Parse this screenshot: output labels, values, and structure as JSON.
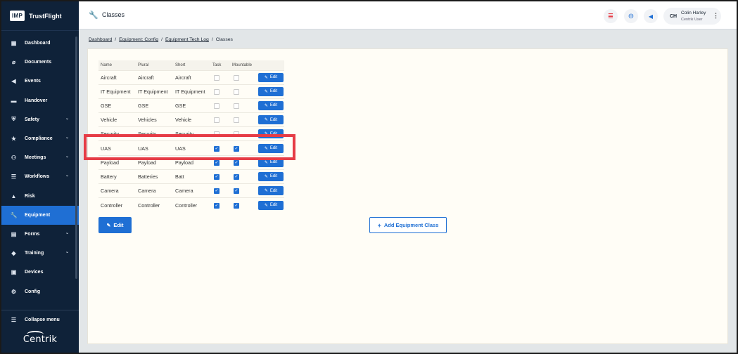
{
  "brand": {
    "logo_text": "IMP",
    "name": "TrustFlight"
  },
  "sidebar": {
    "items": [
      {
        "label": "Dashboard",
        "icon": "dashboard-icon",
        "glyph": "▦",
        "chevron": false,
        "active": false
      },
      {
        "label": "Documents",
        "icon": "paperclip-icon",
        "glyph": "⌀",
        "chevron": false,
        "active": false
      },
      {
        "label": "Events",
        "icon": "megaphone-icon",
        "glyph": "◀",
        "chevron": false,
        "active": false
      },
      {
        "label": "Handover",
        "icon": "handover-icon",
        "glyph": "▬",
        "chevron": false,
        "active": false
      },
      {
        "label": "Safety",
        "icon": "shield-icon",
        "glyph": "⛨",
        "chevron": true,
        "active": false
      },
      {
        "label": "Compliance",
        "icon": "compliance-icon",
        "glyph": "★",
        "chevron": true,
        "active": false
      },
      {
        "label": "Meetings",
        "icon": "meetings-icon",
        "glyph": "⚇",
        "chevron": true,
        "active": false
      },
      {
        "label": "Workflows",
        "icon": "workflows-icon",
        "glyph": "☰",
        "chevron": true,
        "active": false
      },
      {
        "label": "Risk",
        "icon": "risk-icon",
        "glyph": "▲",
        "chevron": false,
        "active": false
      },
      {
        "label": "Equipment",
        "icon": "wrench-icon",
        "glyph": "🔧",
        "chevron": false,
        "active": true
      },
      {
        "label": "Forms",
        "icon": "forms-icon",
        "glyph": "▤",
        "chevron": true,
        "active": false
      },
      {
        "label": "Training",
        "icon": "graduation-cap-icon",
        "glyph": "◆",
        "chevron": true,
        "active": false
      },
      {
        "label": "Devices",
        "icon": "devices-icon",
        "glyph": "▣",
        "chevron": false,
        "active": false
      },
      {
        "label": "Config",
        "icon": "config-icon",
        "glyph": "⚙",
        "chevron": false,
        "active": false
      }
    ],
    "collapse_label": "Collapse menu",
    "footer_logo": "Centrik"
  },
  "header": {
    "title": "Classes",
    "user": {
      "initials": "CH",
      "name": "Colin Harley",
      "role": "Centrik User"
    }
  },
  "breadcrumb": [
    "Dashboard",
    "Equipment: Config",
    "Equipment Tech Log",
    "Classes"
  ],
  "table": {
    "columns": [
      "Name",
      "Plural",
      "Short",
      "Task",
      "Mountable"
    ],
    "edit_label": "Edit",
    "rows": [
      {
        "name": "Aircraft",
        "plural": "Aircraft",
        "short": "Aircraft",
        "task": false,
        "mountable": false
      },
      {
        "name": "IT Equipment",
        "plural": "IT Equipment",
        "short": "IT Equipment",
        "task": false,
        "mountable": false
      },
      {
        "name": "GSE",
        "plural": "GSE",
        "short": "GSE",
        "task": false,
        "mountable": false
      },
      {
        "name": "Vehicle",
        "plural": "Vehicles",
        "short": "Vehicle",
        "task": false,
        "mountable": false
      },
      {
        "name": "Security",
        "plural": "Security",
        "short": "Security",
        "task": false,
        "mountable": false
      },
      {
        "name": "UAS",
        "plural": "UAS",
        "short": "UAS",
        "task": true,
        "mountable": true
      },
      {
        "name": "Payload",
        "plural": "Payload",
        "short": "Payload",
        "task": true,
        "mountable": true
      },
      {
        "name": "Battery",
        "plural": "Batteries",
        "short": "Batt",
        "task": true,
        "mountable": true
      },
      {
        "name": "Camera",
        "plural": "Camera",
        "short": "Camera",
        "task": true,
        "mountable": true
      },
      {
        "name": "Controller",
        "plural": "Controller",
        "short": "Controller",
        "task": true,
        "mountable": true
      }
    ]
  },
  "actions": {
    "edit_label": "Edit",
    "add_label": "Add Equipment Class"
  },
  "colors": {
    "sidebar": "#0f2239",
    "accent": "#1f6fd4",
    "highlight": "#e63c46",
    "panel": "#fffdf6"
  }
}
